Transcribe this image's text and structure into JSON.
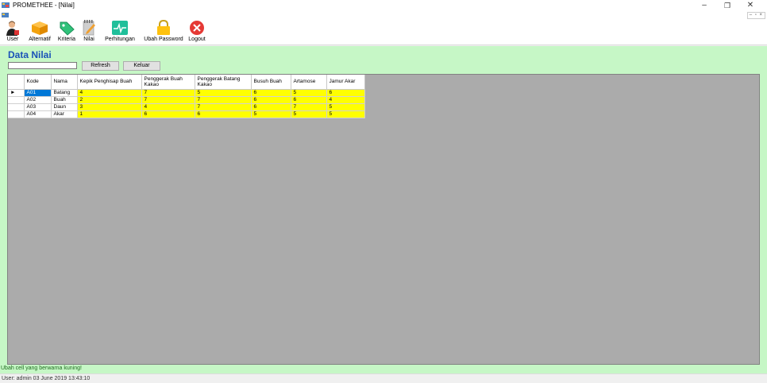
{
  "window": {
    "title": "PROMETHEE - [Nilai]",
    "minimize": "–",
    "maximize": "❐",
    "close": "✕",
    "mdi_controls": "– ▫ ×"
  },
  "toolbar": {
    "items": [
      {
        "label": "User",
        "icon": "user-icon"
      },
      {
        "label": "Alternatif",
        "icon": "box-icon"
      },
      {
        "label": "Kriteria",
        "icon": "tag-icon"
      },
      {
        "label": "Nilai",
        "icon": "notepad-icon"
      },
      {
        "label": "Perhitungan",
        "icon": "pulse-icon"
      },
      {
        "label": "Ubah Password",
        "icon": "lock-icon"
      },
      {
        "label": "Logout",
        "icon": "close-circle-icon"
      }
    ]
  },
  "page": {
    "title": "Data Nilai",
    "search_value": "",
    "refresh_label": "Refresh",
    "keluar_label": "Keluar"
  },
  "grid": {
    "columns": [
      "Kode",
      "Nama",
      "Kepik Penghisap Buah",
      "Penggerak Buah Kakao",
      "Penggerak Batang Kakao",
      "Busuh Buah",
      "Artamose",
      "Jamur Akar"
    ],
    "current_row_marker": "►",
    "rows": [
      {
        "kode": "A01",
        "nama": "Batang",
        "values": [
          "4",
          "7",
          "5",
          "6",
          "5",
          "6"
        ]
      },
      {
        "kode": "A02",
        "nama": "Buah",
        "values": [
          "2",
          "7",
          "7",
          "6",
          "6",
          "4"
        ]
      },
      {
        "kode": "A03",
        "nama": "Daun",
        "values": [
          "3",
          "4",
          "7",
          "6",
          "7",
          "5"
        ]
      },
      {
        "kode": "A04",
        "nama": "Akar",
        "values": [
          "1",
          "6",
          "6",
          "5",
          "5",
          "5"
        ]
      }
    ]
  },
  "hint": "Ubah cell yang berwarna kuning!",
  "status": "User: admin  03 June 2019 13:43:10",
  "colors": {
    "panel": "#c6f7c6",
    "editable_cell": "#ffff00",
    "selected_cell": "#0078d7",
    "title": "#1a52b8",
    "grid_background": "#ababab"
  }
}
